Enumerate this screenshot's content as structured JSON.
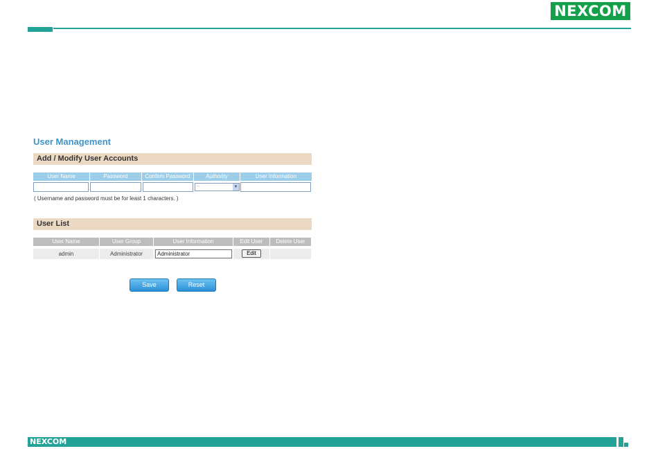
{
  "brand": {
    "logo": "NEXCOM"
  },
  "page": {
    "title": "User Management"
  },
  "add_section": {
    "title": "Add / Modify User Accounts",
    "columns": [
      "User Name",
      "Password",
      "Confirm Password",
      "Authority",
      "User Information"
    ],
    "authority_value": "--",
    "note": "( Username and password must be for least 1 characters. )"
  },
  "user_list": {
    "title": "User List",
    "columns": [
      "User Name",
      "User Group",
      "User Information",
      "Edit User",
      "Delete User"
    ],
    "rows": [
      {
        "user_name": "admin",
        "user_group": "Administrator",
        "user_information": "Administrator",
        "edit_label": "Edit"
      }
    ]
  },
  "actions": {
    "save_label": "Save",
    "reset_label": "Reset"
  },
  "colors": {
    "accent": "#23a397",
    "brand_green": "#14a04a",
    "title_blue": "#3f93c4",
    "section_bg": "#ecd9c4",
    "header_blue": "#9ccde9"
  }
}
